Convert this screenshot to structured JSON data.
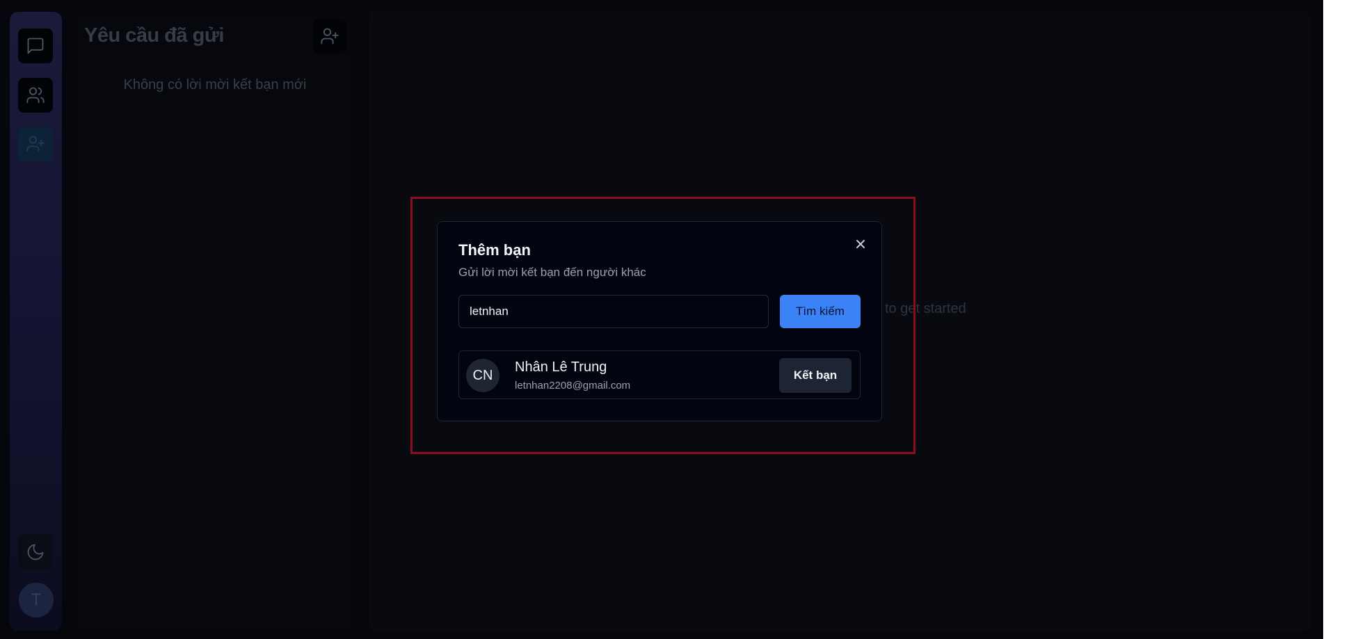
{
  "requests_panel": {
    "title": "Yêu cầu đã gửi",
    "empty_message": "Không có lời mời kết bạn mới"
  },
  "nav": {
    "avatar_initial": "T"
  },
  "main": {
    "hint_visible": "to get started"
  },
  "dialog": {
    "title": "Thêm bạn",
    "subtitle": "Gửi lời mời kết bạn đến người khác",
    "search_value": "letnhan",
    "search_button": "Tìm kiếm",
    "result": {
      "initials": "CN",
      "name": "Nhân Lê Trung",
      "email": "letnhan2208@gmail.com",
      "add_button": "Kết bạn"
    }
  },
  "colors": {
    "accent": "#3b82f6",
    "highlight": "#8e0c1e",
    "background": "#05070c"
  }
}
